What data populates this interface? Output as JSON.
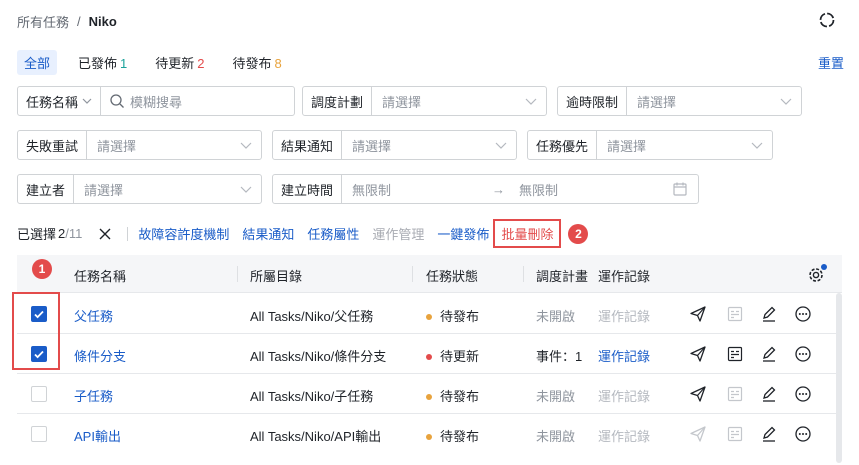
{
  "breadcrumb": {
    "root": "所有任務",
    "sep": "/",
    "current": "Niko"
  },
  "tabs": [
    {
      "label": "全部",
      "count": "",
      "count_color": ""
    },
    {
      "label": "已發佈",
      "count": "1",
      "count_color": "#1ba29a"
    },
    {
      "label": "待更新",
      "count": "2",
      "count_color": "#e34b4b"
    },
    {
      "label": "待發布",
      "count": "8",
      "count_color": "#e8a33d"
    }
  ],
  "reset_label": "重置",
  "filters": {
    "task_name": {
      "label": "任務名稱",
      "placeholder": "模糊搜尋"
    },
    "schedule": {
      "label": "調度計劃",
      "placeholder": "請選擇"
    },
    "timeout": {
      "label": "逾時限制",
      "placeholder": "請選擇"
    },
    "retry": {
      "label": "失敗重試",
      "placeholder": "請選擇"
    },
    "notify": {
      "label": "結果通知",
      "placeholder": "請選擇"
    },
    "priority": {
      "label": "任務優先",
      "placeholder": "請選擇"
    },
    "creator": {
      "label": "建立者",
      "placeholder": "請選擇"
    },
    "created_time": {
      "label": "建立時間",
      "start": "無限制",
      "arrow": "→",
      "end": "無限制"
    }
  },
  "toolbar": {
    "selected_label": "已選擇",
    "selected_count": "2",
    "total": "/11",
    "actions": [
      "故障容許度機制",
      "結果通知",
      "任務屬性",
      "運作管理",
      "一鍵發佈"
    ],
    "bulk_delete": "批量刪除",
    "annotation_2": "2"
  },
  "annotation_1": "1",
  "columns": [
    "任務名稱",
    "所屬目錄",
    "任務狀態",
    "調度計畫",
    "運作記錄"
  ],
  "rows": [
    {
      "checked": true,
      "name": "父任務",
      "dir": "All Tasks/Niko/父任務",
      "status": "待發布",
      "status_color": "#e8a33d",
      "schedule": "未開啟",
      "log": "運作記錄",
      "log_active": false
    },
    {
      "checked": true,
      "name": "條件分支",
      "dir": "All Tasks/Niko/條件分支",
      "status": "待更新",
      "status_color": "#e34b4b",
      "schedule": "事件：1",
      "log": "運作記錄",
      "log_active": true
    },
    {
      "checked": false,
      "name": "子任務",
      "dir": "All Tasks/Niko/子任務",
      "status": "待發布",
      "status_color": "#e8a33d",
      "schedule": "未開啟",
      "log": "運作記錄",
      "log_active": false
    },
    {
      "checked": false,
      "name": "API輸出",
      "dir": "All Tasks/Niko/API輸出",
      "status": "待發布",
      "status_color": "#e8a33d",
      "schedule": "未開啟",
      "log": "運作記錄",
      "log_active": false
    }
  ],
  "colors": {
    "accent": "#1a5cc8",
    "danger": "#e34b4b"
  }
}
